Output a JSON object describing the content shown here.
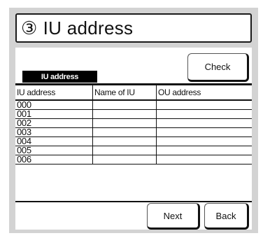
{
  "title": {
    "number": "③",
    "text": "IU address"
  },
  "section_tag": "IU address",
  "buttons": {
    "check": "Check",
    "next": "Next",
    "back": "Back"
  },
  "table": {
    "headers": [
      "IU address",
      "Name of IU",
      "OU address"
    ],
    "rows": [
      [
        "000",
        "",
        ""
      ],
      [
        "001",
        "",
        ""
      ],
      [
        "002",
        "",
        ""
      ],
      [
        "003",
        "",
        ""
      ],
      [
        "004",
        "",
        ""
      ],
      [
        "005",
        "",
        ""
      ],
      [
        "006",
        "",
        ""
      ]
    ]
  }
}
